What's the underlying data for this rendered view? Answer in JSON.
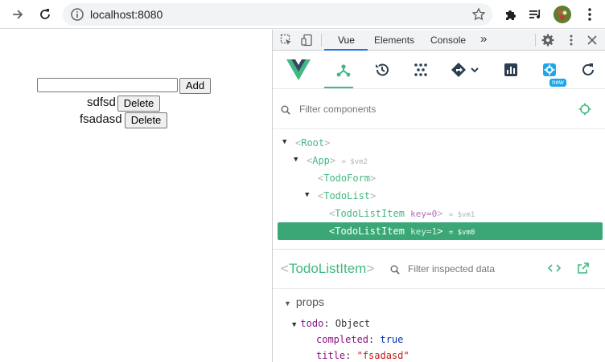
{
  "browser": {
    "url": "localhost:8080"
  },
  "page": {
    "input_value": "",
    "add_label": "Add",
    "items": [
      {
        "text": "sdfsd",
        "delete_label": "Delete"
      },
      {
        "text": "fsadasd",
        "delete_label": "Delete"
      }
    ]
  },
  "devtools": {
    "tabs": [
      "Vue",
      "Elements",
      "Console"
    ],
    "more": "»",
    "active_tab": "Vue",
    "new_badge": "new",
    "filter_placeholder": "Filter components",
    "tree": [
      {
        "name": "Root",
        "arrow": "▼",
        "key": "",
        "vm": ""
      },
      {
        "name": "App",
        "arrow": "▼",
        "key": "",
        "vm": "= $vm2"
      },
      {
        "name": "TodoForm",
        "arrow": "",
        "key": "",
        "vm": ""
      },
      {
        "name": "TodoList",
        "arrow": "▼",
        "key": "",
        "vm": ""
      },
      {
        "name": "TodoListItem",
        "arrow": "",
        "key": "key=0",
        "vm": "= $vm1"
      },
      {
        "name": "TodoListItem",
        "arrow": "",
        "key": "key=1",
        "vm": "= $vm0",
        "selected": true
      }
    ],
    "inspected": {
      "component": "TodoListItem",
      "filter_placeholder": "Filter inspected data",
      "section": "props",
      "prop_name": "todo",
      "prop_type": "Object",
      "fields": [
        {
          "key": "completed",
          "value": "true",
          "kind": "bool"
        },
        {
          "key": "title",
          "value": "\"fsadasd\"",
          "kind": "str"
        }
      ]
    }
  },
  "colors": {
    "vue_green": "#42b883",
    "selection": "#3ba776",
    "tab_underline": "#1a73e8"
  }
}
